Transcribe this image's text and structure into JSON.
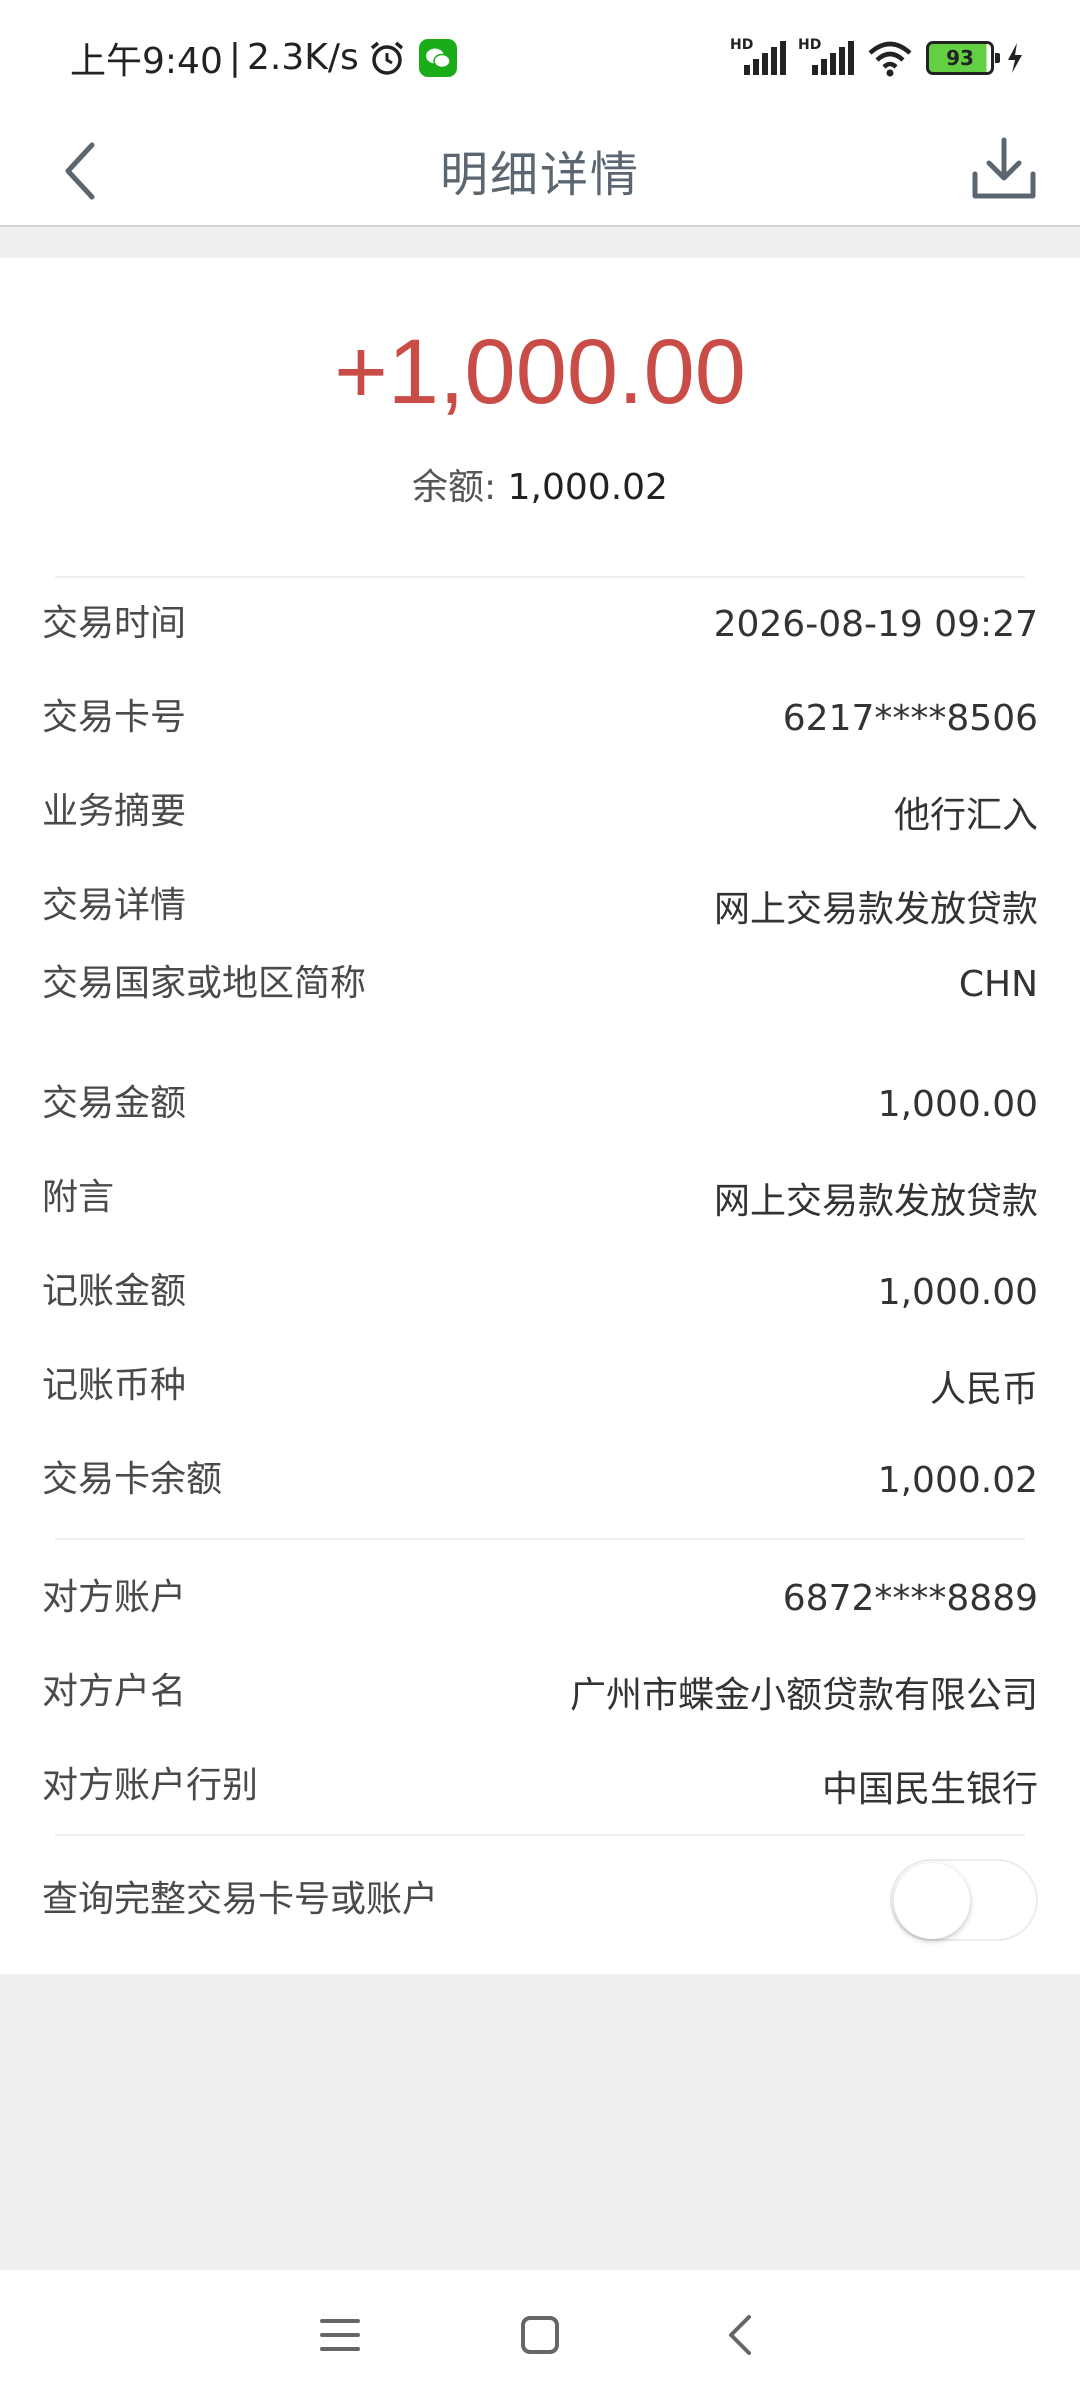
{
  "status_bar": {
    "time": "上午9:40",
    "separator": "|",
    "speed": "2.3K/s",
    "hd_label": "HD",
    "battery": "93"
  },
  "header": {
    "title": "明细详情"
  },
  "summary": {
    "amount": "+1,000.00",
    "balance_label": "余额:",
    "balance_value": "1,000.02"
  },
  "details": [
    {
      "label": "交易时间",
      "value": "2026-08-19 09:27"
    },
    {
      "label": "交易卡号",
      "value": "6217****8506"
    },
    {
      "label": "业务摘要",
      "value": "他行汇入"
    },
    {
      "label": "交易详情",
      "value": "网上交易款发放贷款"
    },
    {
      "label": "交易国家或地区简称",
      "value": "CHN"
    },
    {
      "label": "交易金额",
      "value": "1,000.00"
    },
    {
      "label": "附言",
      "value": "网上交易款发放贷款"
    },
    {
      "label": "记账金额",
      "value": "1,000.00"
    },
    {
      "label": "记账币种",
      "value": "人民币"
    },
    {
      "label": "交易卡余额",
      "value": "1,000.02"
    }
  ],
  "counterparty": [
    {
      "label": "对方账户",
      "value": "6872****8889"
    },
    {
      "label": "对方户名",
      "value": "广州市蝶金小额贷款有限公司"
    },
    {
      "label": "对方账户行别",
      "value": "中国民生银行"
    }
  ],
  "toggle": {
    "label": "查询完整交易卡号或账户",
    "on": false
  },
  "colors": {
    "amount": "#c94c47",
    "title": "#5b6670",
    "background": "#efefef"
  }
}
